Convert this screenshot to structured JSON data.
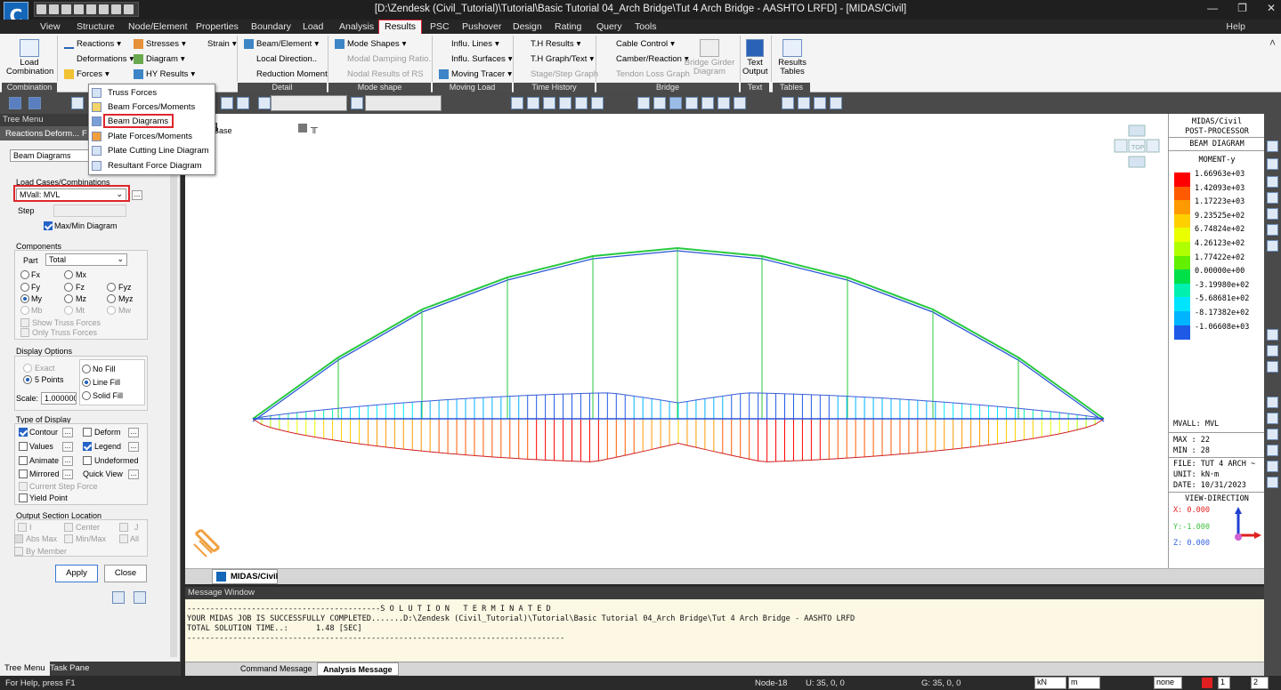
{
  "window": {
    "title": "[D:\\Zendesk (Civil_Tutorial)\\Tutorial\\Basic Tutorial 04_Arch Bridge\\Tut 4 Arch Bridge - AASHTO LRFD] - [MIDAS/Civil]",
    "logo": "C"
  },
  "menu": {
    "tabs": [
      "View",
      "Structure",
      "Node/Element",
      "Properties",
      "Boundary",
      "Load",
      "Analysis",
      "Results",
      "PSC",
      "Pushover",
      "Design",
      "Rating",
      "Query",
      "Tools"
    ],
    "active": "Results",
    "help": "Help"
  },
  "ribbon": {
    "combination": {
      "btn": "Load\nCombination",
      "group": "Combination"
    },
    "results": {
      "reactions": "Reactions",
      "deformations": "Deformations",
      "forces": "Forces",
      "stresses": "Stresses",
      "diagram": "Diagram",
      "hy_results": "HY Results",
      "strain": "Strain"
    },
    "detail": {
      "beam_element": "Beam/Element",
      "local_direction": "Local Direction..",
      "reduction_moment": "Reduction Moment",
      "group": "Detail"
    },
    "mode": {
      "mode_shapes": "Mode Shapes",
      "modal_damping": "Modal Damping Ratio..",
      "nodal_results": "Nodal Results of RS",
      "group": "Mode shape"
    },
    "moving": {
      "influ_lines": "Influ. Lines",
      "influ_surfaces": "Influ. Surfaces",
      "moving_tracer": "Moving Tracer",
      "group": "Moving Load"
    },
    "time": {
      "th_results": "T.H Results",
      "th_graph": "T.H Graph/Text",
      "stage_graph": "Stage/Step Graph",
      "group": "Time History"
    },
    "bridge": {
      "cable_control": "Cable Control",
      "camber": "Camber/Reaction",
      "tendon_loss": "Tendon Loss Graph",
      "bridge_girder": "Bridge Girder\nDiagram",
      "group": "Bridge"
    },
    "text": {
      "btn": "Text\nOutput",
      "group": "Text"
    },
    "tables": {
      "btn": "Results\nTables",
      "group": "Tables"
    }
  },
  "forces_menu": [
    "Truss Forces",
    "Beam Forces/Moments",
    "Beam Diagrams",
    "Plate Forces/Moments",
    "Plate Cutting Line Diagram",
    "Resultant Force Diagram"
  ],
  "tree": {
    "header": "Tree Menu",
    "tabs": [
      "Reactions",
      "Deform...",
      "F"
    ],
    "result_type": "Beam Diagrams",
    "load_cases_label": "Load Cases/Combinations",
    "load_case": "MVall: MVL",
    "step_label": "Step",
    "max_min": "Max/Min Diagram",
    "components_label": "Components",
    "part_label": "Part",
    "part_value": "Total",
    "comps": [
      "Fx",
      "Mx",
      "Fy",
      "Fz",
      "Fyz",
      "My",
      "Mz",
      "Myz",
      "Mb",
      "Mt",
      "Mw"
    ],
    "show_truss": "Show Truss Forces",
    "only_truss": "Only Truss Forces",
    "display_options": "Display Options",
    "exact": "Exact",
    "points": "5 Points",
    "no_fill": "No Fill",
    "line_fill": "Line Fill",
    "solid_fill": "Solid Fill",
    "scale_label": "Scale:",
    "scale_value": "1.000000",
    "type_label": "Type of Display",
    "contour": "Contour",
    "deform": "Deform",
    "values": "Values",
    "legend": "Legend",
    "animate": "Animate",
    "undeformed": "Undeformed",
    "mirrored": "Mirrored",
    "quick_view": "Quick View",
    "current_step": "Current Step Force",
    "yield": "Yield Point",
    "output_loc": "Output Section Location",
    "loc_i": "I",
    "loc_center": "Center",
    "loc_j": "J",
    "abs_max": "Abs Max",
    "min_max": "Min/Max",
    "all": "All",
    "by_member": "By Member",
    "apply": "Apply",
    "close": "Close",
    "bottom_tabs": [
      "Tree Menu",
      "Task Pane"
    ]
  },
  "canvas": {
    "base_label": "Base",
    "cube_label": "TOP"
  },
  "legend": {
    "title1": "MIDAS/Civil",
    "title2": "POST-PROCESSOR",
    "title3": "BEAM DIAGRAM",
    "title4": "MOMENT-y",
    "values": [
      "1.66963e+03",
      "1.42093e+03",
      "1.17223e+03",
      "9.23525e+02",
      "6.74824e+02",
      "4.26123e+02",
      "1.77422e+02",
      "0.00000e+00",
      "-3.19980e+02",
      "-5.68681e+02",
      "-8.17382e+02",
      "-1.06608e+03"
    ],
    "colors": [
      "#ff0000",
      "#ff5a00",
      "#ff9a00",
      "#ffd000",
      "#eaff00",
      "#b0ff00",
      "#62ef00",
      "#00e048",
      "#00f0b0",
      "#00e5ff",
      "#00b4ff",
      "#1f5ae6"
    ],
    "case": "MVALL: MVL",
    "max": "MAX : 22",
    "min": "MIN : 28",
    "file": "FILE: TUT 4 ARCH ~",
    "unit": "UNIT: kN·m",
    "date": "DATE: 10/31/2023",
    "view_dir": "VIEW-DIRECTION",
    "vx": "X: 0.000",
    "vy": "Y:-1.000",
    "vz": "Z: 0.000"
  },
  "doc_tab": "MIDAS/Civil",
  "message": {
    "header": "Message Window",
    "lines": [
      "------------------------------------------S O L U T I O N   T E R M I N A T E D",
      "YOUR MIDAS JOB IS SUCCESSFULLY COMPLETED.......D:\\Zendesk (Civil_Tutorial)\\Tutorial\\Basic Tutorial 04_Arch Bridge\\Tut 4 Arch Bridge - AASHTO LRFD",
      "TOTAL SOLUTION TIME..:      1.48 [SEC]",
      "----------------------------------------------------------------------------------"
    ],
    "tabs": [
      "Command Message",
      "Analysis Message"
    ]
  },
  "status": {
    "help": "For Help, press F1",
    "node": "Node-18",
    "u": "U: 35, 0, 0",
    "g": "G: 35, 0, 0",
    "force_unit": "kN",
    "len_unit": "m",
    "none": "none",
    "page1": "1",
    "page2": "2"
  }
}
